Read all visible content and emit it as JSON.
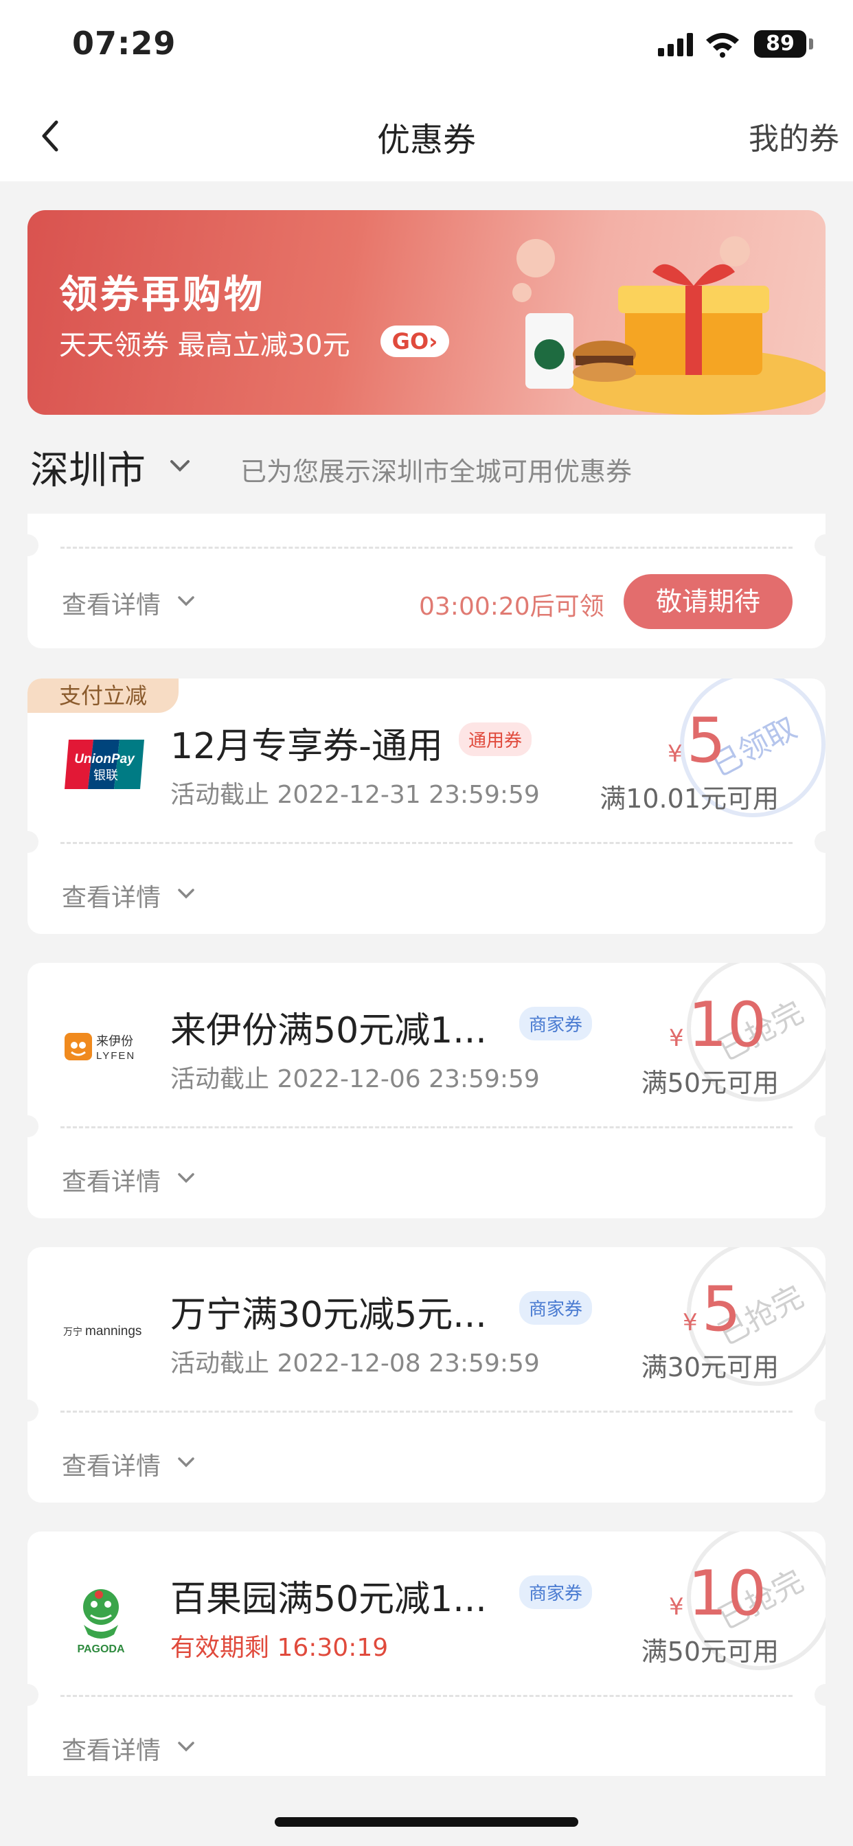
{
  "status_bar": {
    "time": "07:29",
    "battery": "89"
  },
  "nav": {
    "title": "优惠券",
    "right": "我的券"
  },
  "banner": {
    "title": "领券再购物",
    "subtitle": "天天领券  最高立减30元",
    "go": "GO›"
  },
  "city": {
    "name": "深圳市",
    "note": "已为您展示深圳市全城可用优惠券"
  },
  "first_card": {
    "details": "查看详情",
    "countdown": "03:00:20后可领",
    "button": "敬请期待"
  },
  "coupons": [
    {
      "tag": "支付立减",
      "logo": "UnionPay 银联",
      "title": "12月专享券-通用",
      "badge": "通用券",
      "deadline": "活动截止 2022-12-31 23:59:59",
      "yen": "¥",
      "amount": "5",
      "condition": "满10.01元可用",
      "stamp": "已领取",
      "details": "查看详情"
    },
    {
      "logo": "来伊份 LYFEN",
      "title": "来伊份满50元减1...",
      "badge": "商家券",
      "deadline": "活动截止 2022-12-06 23:59:59",
      "yen": "¥",
      "amount": "10",
      "condition": "满50元可用",
      "stamp": "已抢完",
      "details": "查看详情"
    },
    {
      "logo": "万宁 mannings",
      "title": "万宁满30元减5元...",
      "badge": "商家券",
      "deadline": "活动截止 2022-12-08 23:59:59",
      "yen": "¥",
      "amount": "5",
      "condition": "满30元可用",
      "stamp": "已抢完",
      "details": "查看详情"
    },
    {
      "logo": "PAGODA",
      "title": "百果园满50元减1...",
      "badge": "商家券",
      "deadline": "有效期剩 16:30:19",
      "yen": "¥",
      "amount": "10",
      "condition": "满50元可用",
      "stamp": "已抢完",
      "details": "查看详情"
    }
  ]
}
